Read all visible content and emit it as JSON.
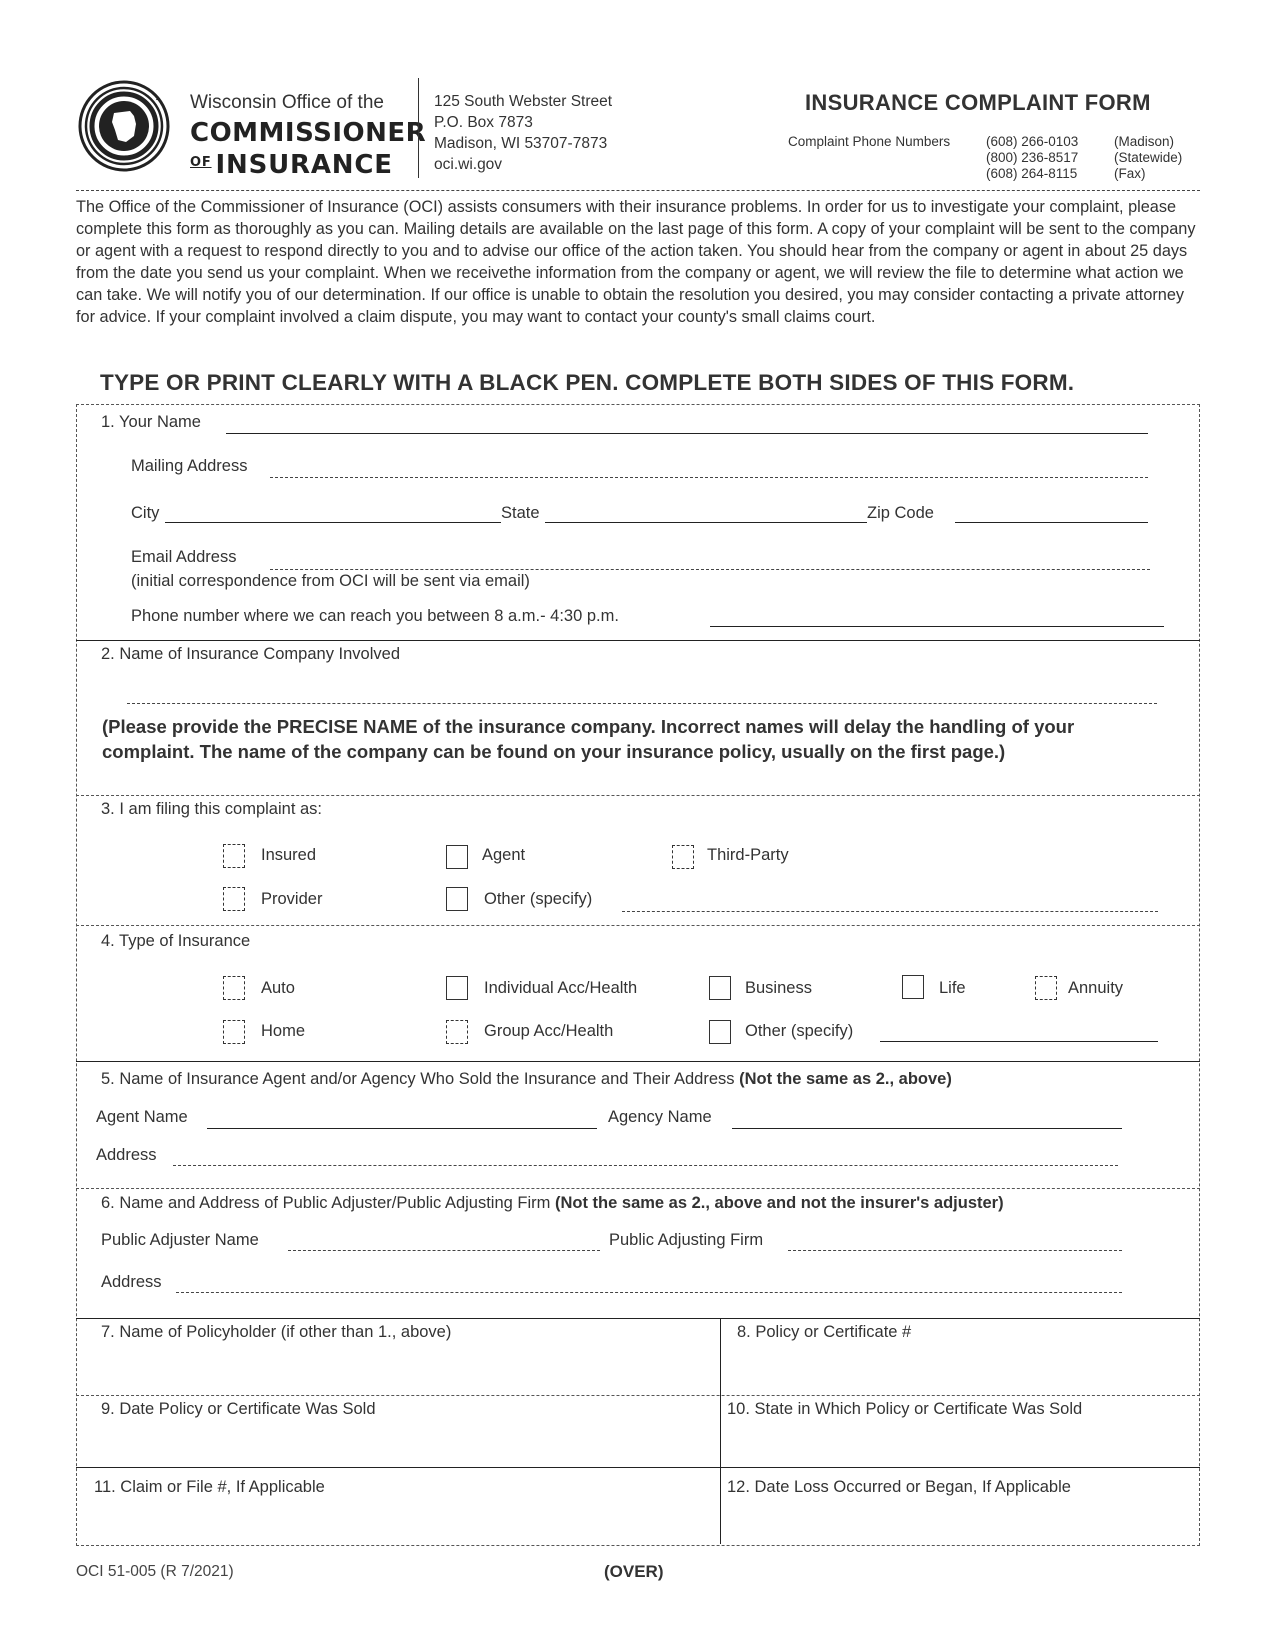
{
  "header": {
    "org_line1": "Wisconsin Office of the",
    "org_line2": "COMMISSIONER",
    "org_line3_of": "OF",
    "org_line3": "INSURANCE",
    "address": [
      "125 South Webster Street",
      "P.O. Box 7873",
      "Madison, WI 53707-7873",
      "oci.wi.gov"
    ],
    "form_title": "INSURANCE COMPLAINT FORM",
    "phones_label": "Complaint Phone Numbers",
    "phones": [
      {
        "number": "(608) 266-0103",
        "location": "(Madison)"
      },
      {
        "number": "(800) 236-8517",
        "location": "(Statewide)"
      },
      {
        "number": "(608) 264-8115",
        "location": "(Fax)"
      }
    ]
  },
  "intro": "The Office of the Commissioner of Insurance (OCI) assists consumers with their insurance problems. In order for us to investigate your complaint, please complete this form as thoroughly as you can. Mailing details are available on the last page of this form. A copy of your complaint will be sent to the company or agent with a request to respond directly to you and to advise our office of the action taken. You should hear from the company or agent in about 25 days from the date you send us your complaint. When we receivethe information from the company or agent, we will review the file to determine what action we can take. We will notify you of our determination. If our office is unable to obtain the resolution you desired, you may consider contacting a private attorney for advice. If your complaint involved a claim dispute, you may want to contact your county's small claims court.",
  "instruction": "TYPE OR PRINT CLEARLY WITH A BLACK PEN.  COMPLETE BOTH SIDES OF THIS FORM.",
  "section1": {
    "your_name": "1. Your Name",
    "mailing_address": "Mailing Address",
    "city": "City",
    "state": "State",
    "zip": "Zip Code",
    "email": "Email Address",
    "email_note": "(initial correspondence from OCI will be sent via email)",
    "phone": "Phone number where we can reach you between 8 a.m.- 4:30 p.m."
  },
  "section2": {
    "label": "2. Name of Insurance Company Involved",
    "note": "(Please provide the PRECISE NAME of the insurance company. Incorrect names will delay the handling of your complaint. The name of the company can be found on your insurance policy, usually on the first page.)"
  },
  "section3": {
    "label": "3. I am filing this complaint as:",
    "options": [
      "Insured",
      "Agent",
      "Third-Party",
      "Provider",
      "Other (specify)"
    ]
  },
  "section4": {
    "label": "4. Type of Insurance",
    "options": [
      "Auto",
      "Individual Acc/Health",
      "Business",
      "Life",
      "Annuity",
      "Home",
      "Group Acc/Health",
      "Other (specify)"
    ]
  },
  "section5": {
    "label": "5. Name of Insurance Agent and/or Agency Who Sold the Insurance and Their Address ",
    "label_bold": "(Not the same as 2., above)",
    "agent_name": "Agent Name",
    "agency_name": "Agency Name",
    "address": "Address"
  },
  "section6": {
    "label": "6. Name and Address of Public Adjuster/Public Adjusting Firm ",
    "label_bold": "(Not the same as 2., above and not the insurer's adjuster)",
    "adjuster_name": "Public Adjuster Name",
    "firm": "Public Adjusting Firm",
    "address": "Address"
  },
  "boxes": {
    "b7": "7. Name of Policyholder (if other than 1., above)",
    "b8": "8. Policy or Certificate #",
    "b9": "9. Date Policy or Certificate Was Sold",
    "b10": "10. State in Which Policy or Certificate Was Sold",
    "b11": "11. Claim or File #, If Applicable",
    "b12": "12. Date Loss Occurred or Began, If Applicable"
  },
  "footer": {
    "form_number": "OCI 51-005 (R 7/2021)",
    "over": "(OVER)"
  }
}
